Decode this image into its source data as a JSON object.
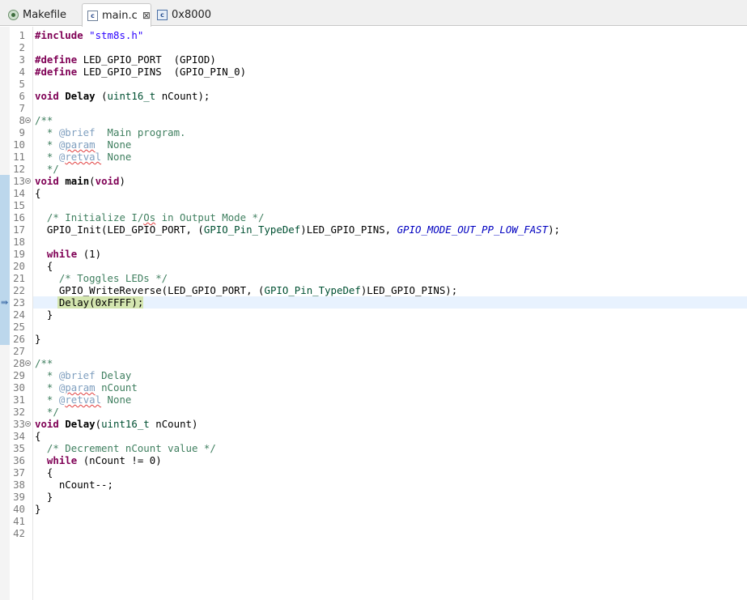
{
  "tabs": [
    {
      "name": "tab-makefile",
      "label": "Makefile",
      "icon": "makefile-icon",
      "active": false
    },
    {
      "name": "tab-main-c",
      "label": "main.c",
      "icon": "c-file-icon",
      "active": true,
      "close": "⊠"
    },
    {
      "name": "tab-memory-0x8000",
      "label": "0x8000",
      "icon": "memory-view-icon",
      "active": false
    }
  ],
  "editor": {
    "current_line": 23,
    "lines": [
      {
        "n": "1",
        "segs": [
          [
            "pp",
            "#include "
          ],
          [
            "str",
            "\"stm8s.h\""
          ]
        ]
      },
      {
        "n": "2",
        "segs": []
      },
      {
        "n": "3",
        "segs": [
          [
            "pp",
            "#define "
          ],
          [
            "",
            "LED_GPIO_PORT  (GPIOD)"
          ]
        ]
      },
      {
        "n": "4",
        "segs": [
          [
            "pp",
            "#define "
          ],
          [
            "",
            "LED_GPIO_PINS  (GPIO_PIN_0)"
          ]
        ]
      },
      {
        "n": "5",
        "segs": []
      },
      {
        "n": "6",
        "segs": [
          [
            "kw",
            "void "
          ],
          [
            "fn",
            "Delay"
          ],
          [
            "",
            " ("
          ],
          [
            "tp",
            "uint16_t"
          ],
          [
            "",
            " nCount);"
          ]
        ]
      },
      {
        "n": "7",
        "segs": []
      },
      {
        "n": "8",
        "fold": true,
        "segs": [
          [
            "cm",
            "/**"
          ]
        ]
      },
      {
        "n": "9",
        "segs": [
          [
            "cm",
            "  * "
          ],
          [
            "tag",
            "@brief"
          ],
          [
            "cm",
            "  Main program."
          ]
        ]
      },
      {
        "n": "10",
        "segs": [
          [
            "cm",
            "  * "
          ],
          [
            "tag",
            "@param"
          ],
          [
            "cm",
            "  None"
          ]
        ]
      },
      {
        "n": "11",
        "segs": [
          [
            "cm",
            "  * "
          ],
          [
            "tag",
            "@retval"
          ],
          [
            "cm",
            " None"
          ]
        ]
      },
      {
        "n": "12",
        "segs": [
          [
            "cm",
            "  */"
          ]
        ]
      },
      {
        "n": "13",
        "fold": true,
        "segs": [
          [
            "kw",
            "void "
          ],
          [
            "fn",
            "main"
          ],
          [
            "",
            "("
          ],
          [
            "kw",
            "void"
          ],
          [
            "",
            ")"
          ]
        ]
      },
      {
        "n": "14",
        "segs": [
          [
            "",
            "{"
          ]
        ]
      },
      {
        "n": "15",
        "segs": []
      },
      {
        "n": "16",
        "segs": [
          [
            "",
            "  "
          ],
          [
            "cm",
            "/* Initialize I/Os in Output Mode */"
          ]
        ]
      },
      {
        "n": "17",
        "segs": [
          [
            "",
            "  GPIO_Init(LED_GPIO_PORT, ("
          ],
          [
            "tp",
            "GPIO_Pin_TypeDef"
          ],
          [
            "",
            ")LED_GPIO_PINS, "
          ],
          [
            "en",
            "GPIO_MODE_OUT_PP_LOW_FAST"
          ],
          [
            "",
            ");"
          ]
        ]
      },
      {
        "n": "18",
        "segs": []
      },
      {
        "n": "19",
        "segs": [
          [
            "",
            "  "
          ],
          [
            "kw",
            "while"
          ],
          [
            "",
            " (1)"
          ]
        ]
      },
      {
        "n": "20",
        "segs": [
          [
            "",
            "  {"
          ]
        ]
      },
      {
        "n": "21",
        "segs": [
          [
            "",
            "    "
          ],
          [
            "cm",
            "/* Toggles LEDs */"
          ]
        ]
      },
      {
        "n": "22",
        "segs": [
          [
            "",
            "    GPIO_WriteReverse(LED_GPIO_PORT, ("
          ],
          [
            "tp",
            "GPIO_Pin_TypeDef"
          ],
          [
            "",
            ")LED_GPIO_PINS);"
          ]
        ]
      },
      {
        "n": "23",
        "exec": "Delay(0xFFFF);",
        "segs": [
          [
            "",
            "    Delay(0xFFFF);"
          ]
        ]
      },
      {
        "n": "24",
        "segs": [
          [
            "",
            "  }"
          ]
        ]
      },
      {
        "n": "25",
        "segs": []
      },
      {
        "n": "26",
        "segs": [
          [
            "",
            "}"
          ]
        ]
      },
      {
        "n": "27",
        "segs": []
      },
      {
        "n": "28",
        "fold": true,
        "segs": [
          [
            "cm",
            "/**"
          ]
        ]
      },
      {
        "n": "29",
        "segs": [
          [
            "cm",
            "  * "
          ],
          [
            "tag",
            "@brief"
          ],
          [
            "cm",
            " Delay"
          ]
        ]
      },
      {
        "n": "30",
        "segs": [
          [
            "cm",
            "  * "
          ],
          [
            "tag",
            "@param"
          ],
          [
            "cm",
            " nCount"
          ]
        ]
      },
      {
        "n": "31",
        "segs": [
          [
            "cm",
            "  * "
          ],
          [
            "tag",
            "@retval"
          ],
          [
            "cm",
            " None"
          ]
        ]
      },
      {
        "n": "32",
        "segs": [
          [
            "cm",
            "  */"
          ]
        ]
      },
      {
        "n": "33",
        "fold": true,
        "segs": [
          [
            "kw",
            "void "
          ],
          [
            "fn",
            "Delay"
          ],
          [
            "",
            "("
          ],
          [
            "tp",
            "uint16_t"
          ],
          [
            "",
            " nCount)"
          ]
        ]
      },
      {
        "n": "34",
        "segs": [
          [
            "",
            "{"
          ]
        ]
      },
      {
        "n": "35",
        "segs": [
          [
            "",
            "  "
          ],
          [
            "cm",
            "/* Decrement nCount value */"
          ]
        ]
      },
      {
        "n": "36",
        "segs": [
          [
            "",
            "  "
          ],
          [
            "kw",
            "while"
          ],
          [
            "",
            " (nCount != 0)"
          ]
        ]
      },
      {
        "n": "37",
        "segs": [
          [
            "",
            "  {"
          ]
        ]
      },
      {
        "n": "38",
        "segs": [
          [
            "",
            "    nCount--;"
          ]
        ]
      },
      {
        "n": "39",
        "segs": [
          [
            "",
            "  }"
          ]
        ]
      },
      {
        "n": "40",
        "segs": [
          [
            "",
            "}"
          ]
        ]
      },
      {
        "n": "41",
        "segs": []
      },
      {
        "n": "42",
        "segs": []
      }
    ]
  },
  "colors": {
    "keyword": "#7f0055",
    "string": "#2a00ff",
    "comment": "#3f7f5f",
    "javadoc_tag": "#7f9fbf",
    "type": "#005032",
    "enum": "#0000c0",
    "current_line_bg": "#e8f2fe",
    "exec_highlight": "#d4e6b0"
  }
}
